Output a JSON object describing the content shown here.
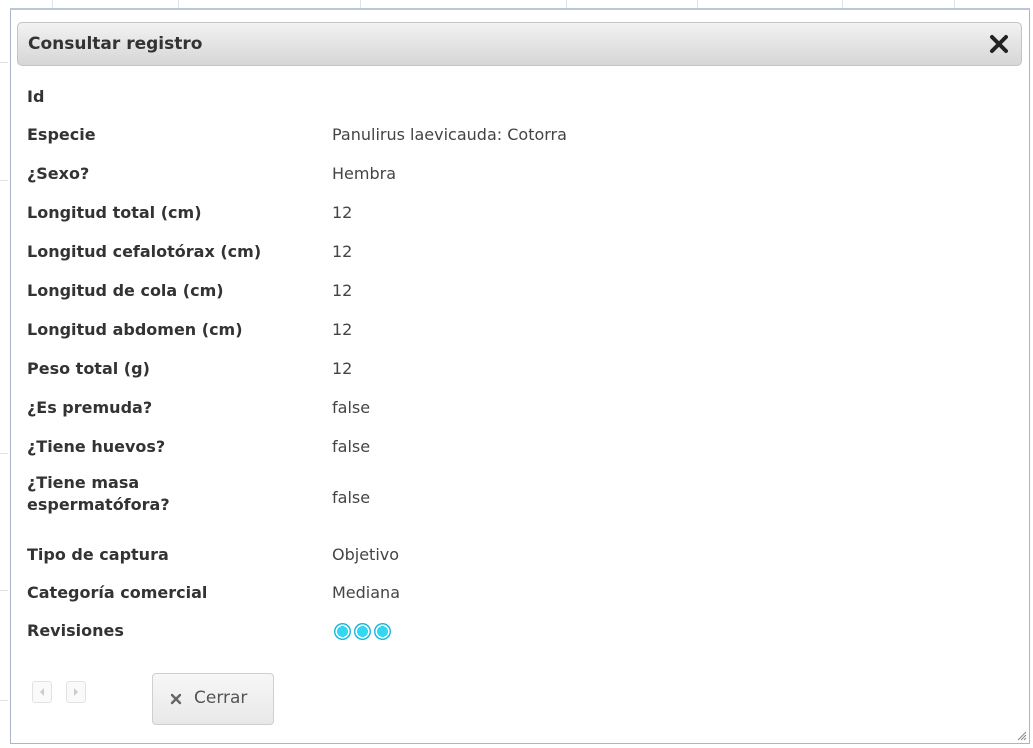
{
  "dialog": {
    "title": "Consultar registro",
    "close_icon": "close-x-icon"
  },
  "fields": [
    {
      "label": "Id",
      "value": ""
    },
    {
      "label": "Especie",
      "value": "Panulirus laevicauda: Cotorra"
    },
    {
      "label": "¿Sexo?",
      "value": "Hembra"
    },
    {
      "label": "Longitud total (cm)",
      "value": "12"
    },
    {
      "label": "Longitud cefalotórax (cm)",
      "value": "12"
    },
    {
      "label": "Longitud de cola (cm)",
      "value": "12"
    },
    {
      "label": "Longitud abdomen (cm)",
      "value": "12"
    },
    {
      "label": "Peso total (g)",
      "value": "12"
    },
    {
      "label": "¿Es premuda?",
      "value": "false"
    },
    {
      "label": "¿Tiene huevos?",
      "value": "false"
    },
    {
      "label": "¿Tiene masa espermatófora?",
      "value": "false"
    },
    {
      "label": "Tipo de captura",
      "value": "Objetivo"
    },
    {
      "label": "Categoría comercial",
      "value": "Mediana"
    },
    {
      "label": "Revisiones",
      "value": ""
    }
  ],
  "revisiones": {
    "count": 3,
    "color": "#34d7f2"
  },
  "footer": {
    "prev_icon": "triangle-left-icon",
    "next_icon": "triangle-right-icon",
    "close_button_label": "Cerrar",
    "close_button_icon": "close-x-icon"
  }
}
